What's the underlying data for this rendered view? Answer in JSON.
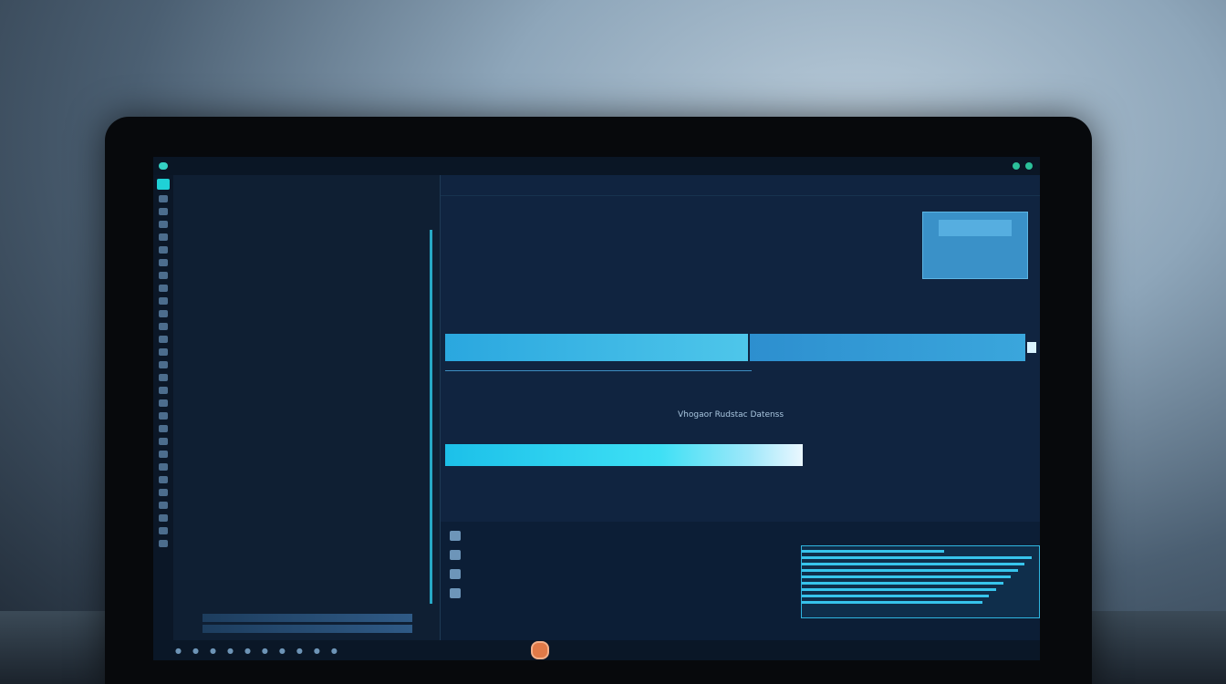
{
  "colors": {
    "screen_bg": "#0d1a2b",
    "accent_cyan": "#1fd1d6",
    "banner_blue": "#2aa7df"
  },
  "topbar": {
    "title": "",
    "right_text": ""
  },
  "left_panel": {
    "header": "",
    "rows": [
      {
        "name": "",
        "value": ""
      },
      {
        "name": "",
        "value": ""
      },
      {
        "name": "",
        "value": ""
      },
      {
        "name": "",
        "value": ""
      },
      {
        "name": "",
        "value": ""
      },
      {
        "name": "",
        "value": ""
      },
      {
        "name": "",
        "value": ""
      },
      {
        "name": "",
        "value": ""
      },
      {
        "name": "",
        "value": ""
      },
      {
        "name": "",
        "value": ""
      },
      {
        "name": "",
        "value": ""
      },
      {
        "name": "",
        "value": ""
      },
      {
        "name": "",
        "value": ""
      },
      {
        "name": "",
        "value": ""
      },
      {
        "name": "",
        "value": ""
      },
      {
        "name": "",
        "value": ""
      },
      {
        "name": "",
        "value": ""
      },
      {
        "name": "",
        "value": ""
      },
      {
        "name": "",
        "value": ""
      },
      {
        "name": "",
        "value": ""
      },
      {
        "name": "",
        "value": ""
      },
      {
        "name": "",
        "value": ""
      },
      {
        "name": "",
        "value": ""
      },
      {
        "name": "",
        "value": ""
      },
      {
        "name": "",
        "value": ""
      },
      {
        "name": "",
        "value": ""
      },
      {
        "name": "",
        "value": ""
      },
      {
        "name": "",
        "value": ""
      }
    ]
  },
  "main": {
    "tab_left": "",
    "tab_right": "",
    "center_text": "Vhogaor Rudstac Datenss"
  },
  "dock": {
    "label": ""
  }
}
